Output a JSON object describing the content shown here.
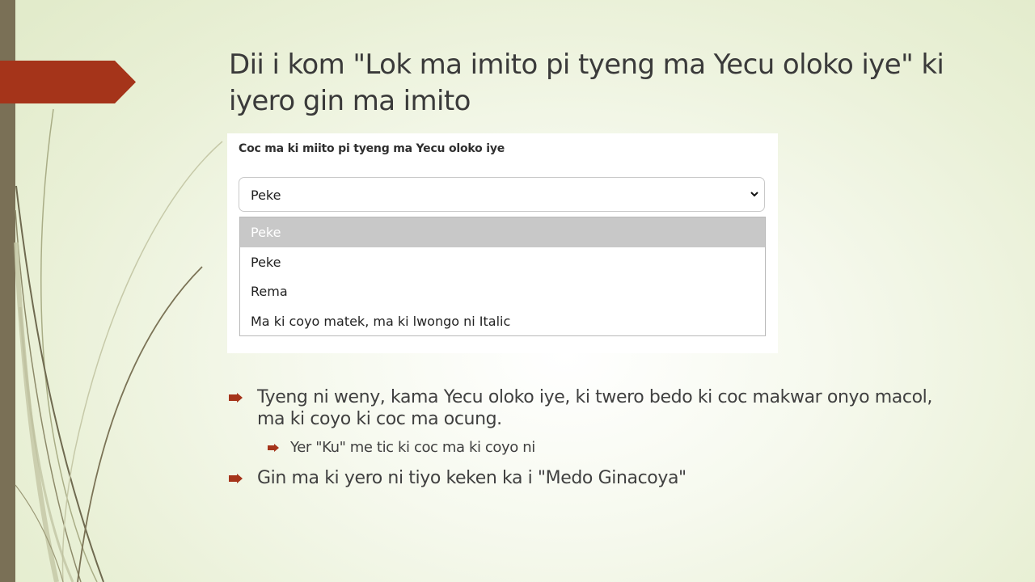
{
  "slide": {
    "title": "Dii i kom \"Lok ma imito pi tyeng ma Yecu oloko iye\" ki iyero gin ma imito"
  },
  "form": {
    "label": "Coc ma ki miito pi tyeng ma Yecu oloko iye",
    "selected_value": "Peke",
    "options": [
      {
        "label": "Peke",
        "highlighted": true
      },
      {
        "label": "Peke",
        "highlighted": false
      },
      {
        "label": "Rema",
        "highlighted": false
      },
      {
        "label": "Ma ki coyo matek, ma ki lwongo ni Italic",
        "highlighted": false
      }
    ]
  },
  "bullets": [
    {
      "level": 1,
      "text": "Tyeng ni weny, kama Yecu oloko iye, ki twero bedo ki coc makwar onyo macol, ma ki coyo ki coc ma ocung."
    },
    {
      "level": 2,
      "text": "Yer \"Ku\" me tic ki coc ma ki coyo ni"
    },
    {
      "level": 1,
      "text": "Gin ma ki yero ni tiyo keken ka i \"Medo Ginacoya\""
    }
  ],
  "colors": {
    "accent": "#a5341a",
    "left_bar": "#7a7056",
    "highlight": "#c8c8c8"
  },
  "icons": {
    "bullet": "arrow-bullet-icon",
    "dropdown": "chevron-down-icon"
  }
}
